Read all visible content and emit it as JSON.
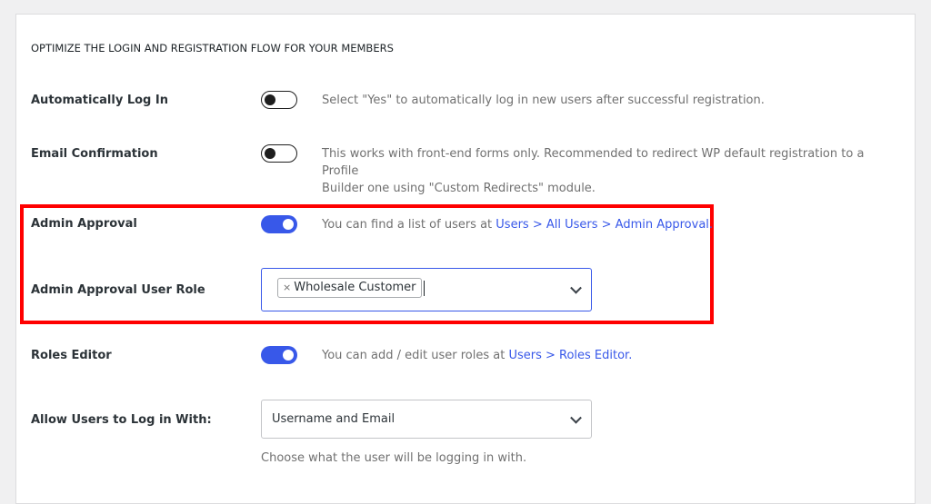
{
  "section": {
    "title": "OPTIMIZE THE LOGIN AND REGISTRATION FLOW FOR YOUR MEMBERS"
  },
  "settings": {
    "auto_login": {
      "label": "Automatically Log In",
      "enabled": false,
      "description": "Select \"Yes\" to automatically log in new users after successful registration."
    },
    "email_confirmation": {
      "label": "Email Confirmation",
      "enabled": false,
      "description_line1": "This works with front-end forms only. Recommended to redirect WP default registration to a Profile",
      "description_line2": "Builder one using \"Custom Redirects\" module."
    },
    "admin_approval": {
      "label": "Admin Approval",
      "enabled": true,
      "description_prefix": "You can find a list of users at ",
      "link_text": "Users > All Users > Admin Approval."
    },
    "admin_approval_user_role": {
      "label": "Admin Approval User Role",
      "selected_chips": [
        {
          "remove_glyph": "×",
          "label": "Wholesale Customer"
        }
      ]
    },
    "roles_editor": {
      "label": "Roles Editor",
      "enabled": true,
      "description_prefix": "You can add / edit user roles at ",
      "link_text": "Users > Roles Editor."
    },
    "login_with": {
      "label": "Allow Users to Log in With:",
      "value": "Username and Email",
      "hint": "Choose what the user will be logging in with."
    }
  },
  "colors": {
    "accent": "#3858e9",
    "highlight_border": "#ff0000",
    "page_bg": "#f0f0f1"
  },
  "icons": {
    "dropdown": "chevron-down-icon",
    "chip_remove": "close-icon"
  }
}
